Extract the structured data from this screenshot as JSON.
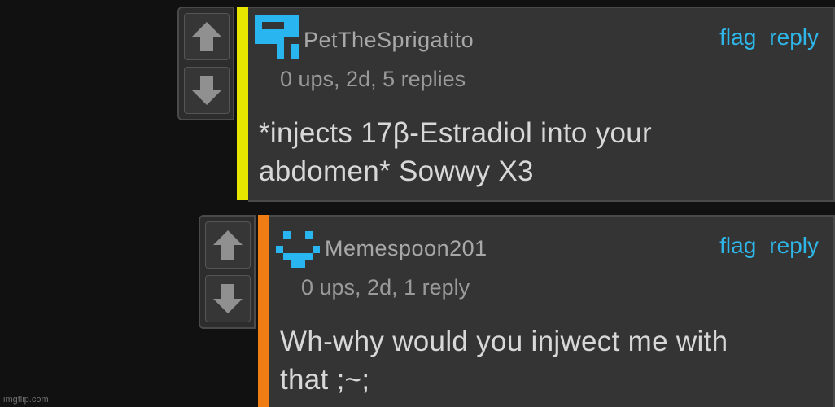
{
  "comments": [
    {
      "username": "PetTheSprigatito",
      "meta": "0 ups, 2d, 5 replies",
      "body": [
        "*injects 17β-Estradiol into your",
        "abdomen* Sowwy X3"
      ],
      "flag_label": "flag",
      "reply_label": "reply",
      "stripe_color": "#e6e600",
      "avatar_icon": "user-avatar-icon"
    },
    {
      "username": "Memespoon201",
      "meta": "0 ups, 2d, 1 reply",
      "body": [
        "Wh-why would you injwect me with",
        "that ;~;"
      ],
      "flag_label": "flag",
      "reply_label": "reply",
      "stripe_color": "#f07c14",
      "avatar_icon": "user-avatar-icon"
    }
  ],
  "watermark": "imgflip.com",
  "colors": {
    "background": "#111111",
    "panel": "#343434",
    "link": "#2fb6e8",
    "avatar": "#29b6f0"
  }
}
